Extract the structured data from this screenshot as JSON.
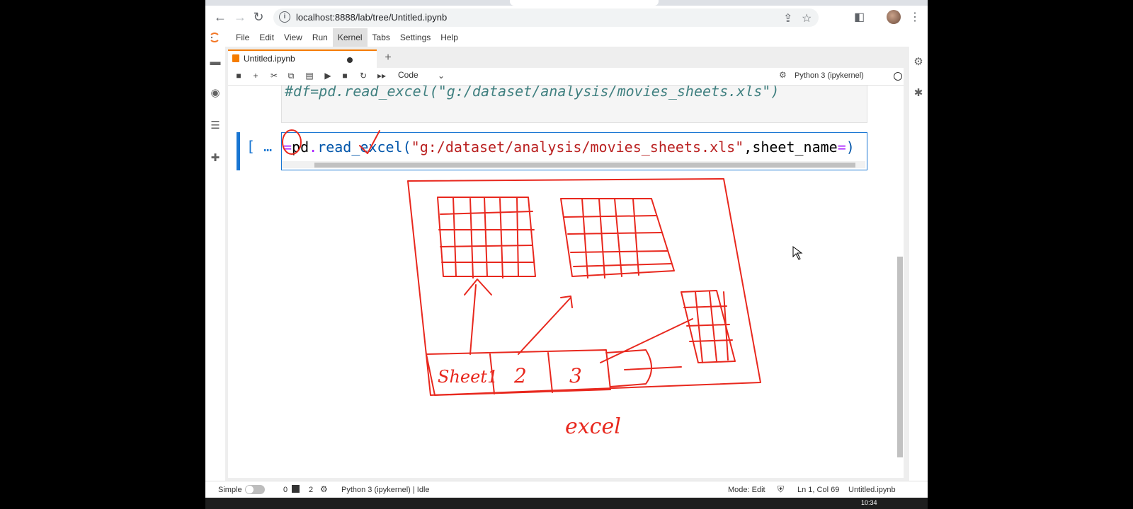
{
  "browser": {
    "url": "localhost:8888/lab/tree/Untitled.ipynb"
  },
  "menu": [
    "File",
    "Edit",
    "View",
    "Run",
    "Kernel",
    "Tabs",
    "Settings",
    "Help"
  ],
  "notebook_tab": {
    "title": "Untitled.ipynb"
  },
  "toolbar": {
    "cell_type": "Code",
    "kernel": "Python 3 (ipykernel)"
  },
  "cells": {
    "prev_code": "#df=pd.read_excel(\"g:/dataset/analysis/movies_sheets.xls\")",
    "prompt": "[ …",
    "code_tokens": {
      "eq": "=",
      "pd": "pd",
      "dot": ".",
      "fn": "read_excel",
      "open": "(",
      "path": "\"g:/dataset/analysis/movies_sheets.xls\"",
      "comma": ",",
      "kw": "sheet_name",
      "eq2": "=",
      "close": ")"
    }
  },
  "sketch": {
    "sheet1_label": "Sheet1",
    "sheet2_label": "2",
    "sheet3_label": "3",
    "caption": "excel",
    "ink_color": "#e8281e"
  },
  "status": {
    "mode_label": "Simple",
    "terminals": "0",
    "kernels": "2",
    "kernel_status": "Python 3 (ipykernel) | Idle",
    "mode": "Mode: Edit",
    "position": "Ln 1, Col 69",
    "file": "Untitled.ipynb"
  },
  "taskbar": {
    "time": "10:34"
  }
}
